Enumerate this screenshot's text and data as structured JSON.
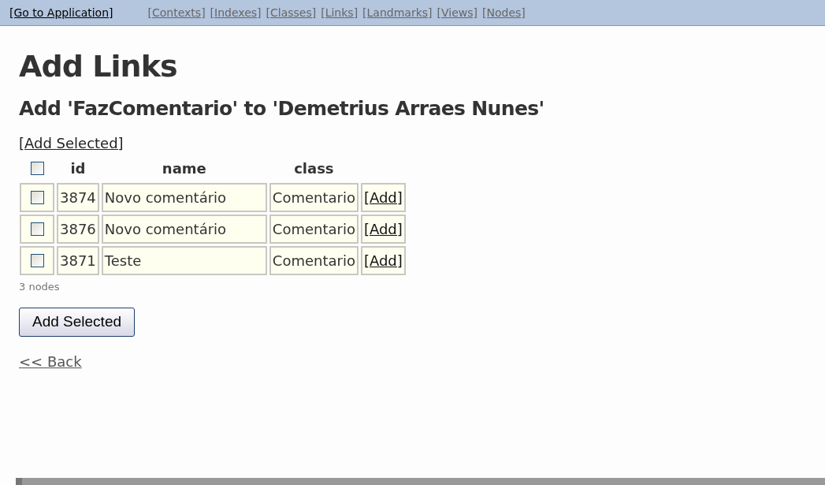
{
  "nav": {
    "home_link": "[Go to Application]",
    "links": [
      "[Contexts]",
      "[Indexes]",
      "[Classes]",
      "[Links]",
      "[Landmarks]",
      "[Views]",
      "[Nodes]"
    ]
  },
  "title": "Add Links",
  "subtitle": "Add 'FazComentario' to 'Demetrius Arraes Nunes'",
  "add_selected_link": "[Add Selected]",
  "table": {
    "select_all": {
      "checked": false
    },
    "columns": [
      "id",
      "name",
      "class"
    ],
    "rows": [
      {
        "checked": false,
        "id": "3874",
        "name": "Novo comentário",
        "class": "Comentario",
        "action": "[Add]"
      },
      {
        "checked": false,
        "id": "3876",
        "name": "Novo comentário",
        "class": "Comentario",
        "action": "[Add]"
      },
      {
        "checked": false,
        "id": "3871",
        "name": "Teste",
        "class": "Comentario",
        "action": "[Add]"
      }
    ]
  },
  "count": "3 nodes",
  "add_selected_button": "Add Selected",
  "back_link": "<< Back"
}
